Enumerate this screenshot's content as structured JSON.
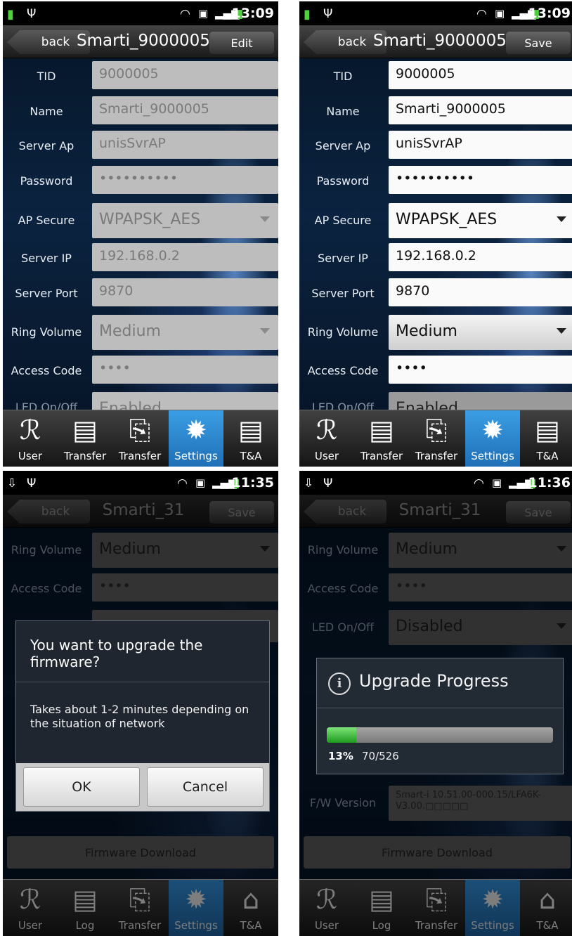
{
  "panels": [
    {
      "time": "13:09",
      "back": "back",
      "title": "Smarti_9000005",
      "action": "Edit",
      "fields": [
        {
          "label": "TID",
          "value": "9000005"
        },
        {
          "label": "Name",
          "value": "Smarti_9000005"
        },
        {
          "label": "Server Ap",
          "value": "unisSvrAP"
        },
        {
          "label": "Password",
          "value": "••••••••••"
        },
        {
          "label": "AP Secure",
          "value": "WPAPSK_AES"
        },
        {
          "label": "Server IP",
          "value": "192.168.0.2"
        },
        {
          "label": "Server Port",
          "value": "9870"
        },
        {
          "label": "Ring Volume",
          "value": "Medium"
        },
        {
          "label": "Access Code",
          "value": "••••"
        },
        {
          "label": "LED On/Off",
          "value": "Enabled"
        }
      ],
      "tabs": [
        "User",
        "Transfer",
        "Transfer",
        "Settings",
        "T&A"
      ]
    },
    {
      "time": "13:09",
      "back": "back",
      "title": "Smarti_9000005",
      "action": "Save",
      "fields": [
        {
          "label": "TID",
          "value": "9000005"
        },
        {
          "label": "Name",
          "value": "Smarti_9000005"
        },
        {
          "label": "Server Ap",
          "value": "unisSvrAP"
        },
        {
          "label": "Password",
          "value": "••••••••••"
        },
        {
          "label": "AP Secure",
          "value": "WPAPSK_AES"
        },
        {
          "label": "Server IP",
          "value": "192.168.0.2"
        },
        {
          "label": "Server Port",
          "value": "9870"
        },
        {
          "label": "Ring Volume",
          "value": "Medium"
        },
        {
          "label": "Access Code",
          "value": "••••"
        },
        {
          "label": "LED On/Off",
          "value": "Enabled"
        }
      ],
      "tabs": [
        "User",
        "Transfer",
        "Transfer",
        "Settings",
        "T&A"
      ]
    },
    {
      "time": "11:35",
      "back": "back",
      "title": "Smarti_31",
      "action": "Save",
      "fields": [
        {
          "label": "Ring Volume",
          "value": "Medium"
        },
        {
          "label": "Access Code",
          "value": "••••"
        }
      ],
      "firmware_button": "Firmware Download",
      "dialog": {
        "title": "You want to upgrade the firmware?",
        "message": "Takes about 1-2 minutes depending on the situation of network",
        "ok": "OK",
        "cancel": "Cancel"
      },
      "tabs": [
        "User",
        "Log",
        "Transfer",
        "Settings",
        "T&A"
      ]
    },
    {
      "time": "11:36",
      "back": "back",
      "title": "Smarti_31",
      "action": "Save",
      "fields": [
        {
          "label": "Ring Volume",
          "value": "Medium"
        },
        {
          "label": "Access Code",
          "value": "••••"
        },
        {
          "label": "LED On/Off",
          "value": "Disabled"
        },
        {
          "label": "F/W Version",
          "value": "Smart-i 10.51.00-000.15/LFA6K-V3.00.□□□□□"
        }
      ],
      "firmware_button": "Firmware Download",
      "progress": {
        "title": "Upgrade Progress",
        "percent_label": "13%",
        "count": "70/526",
        "fraction": 0.13
      },
      "tabs": [
        "User",
        "Log",
        "Transfer",
        "Settings",
        "T&A"
      ]
    }
  ],
  "icons": [
    "battery-icon",
    "usb-icon",
    "wifi-icon",
    "sim-icon",
    "signal-icon",
    "user-icon",
    "document-icon",
    "folder-transfer-icon",
    "gear-icon",
    "house-icon",
    "info-icon"
  ]
}
